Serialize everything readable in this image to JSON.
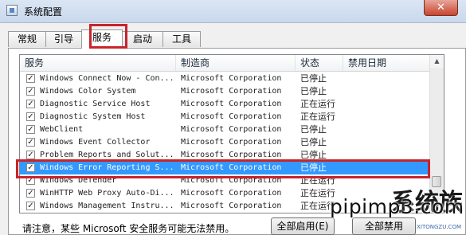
{
  "window": {
    "title": "系统配置",
    "close_glyph": "✕"
  },
  "tabs": [
    {
      "label": "常规"
    },
    {
      "label": "引导"
    },
    {
      "label": "服务",
      "active": true
    },
    {
      "label": "启动"
    },
    {
      "label": "工具"
    }
  ],
  "table": {
    "columns": [
      "服务",
      "制造商",
      "状态",
      "禁用日期"
    ],
    "rows": [
      {
        "name": "Windows Connect Now - Con...",
        "vendor": "Microsoft Corporation",
        "status": "已停止",
        "checked": true
      },
      {
        "name": "Windows Color System",
        "vendor": "Microsoft Corporation",
        "status": "已停止",
        "checked": true
      },
      {
        "name": "Diagnostic Service Host",
        "vendor": "Microsoft Corporation",
        "status": "正在运行",
        "checked": true
      },
      {
        "name": "Diagnostic System Host",
        "vendor": "Microsoft Corporation",
        "status": "正在运行",
        "checked": true
      },
      {
        "name": "WebClient",
        "vendor": "Microsoft Corporation",
        "status": "已停止",
        "checked": true
      },
      {
        "name": "Windows Event Collector",
        "vendor": "Microsoft Corporation",
        "status": "已停止",
        "checked": true
      },
      {
        "name": "Problem Reports and Solut...",
        "vendor": "Microsoft Corporation",
        "status": "已停止",
        "checked": true
      },
      {
        "name": "Windows Error Reporting S...",
        "vendor": "Microsoft Corporation",
        "status": "已停止",
        "checked": true,
        "selected": true
      },
      {
        "name": "Windows Defender",
        "vendor": "Microsoft Corporation",
        "status": "正在运行",
        "checked": true
      },
      {
        "name": "WinHTTP Web Proxy Auto-Di...",
        "vendor": "Microsoft Corporation",
        "status": "正在运行",
        "checked": true
      },
      {
        "name": "Windows Management Instru...",
        "vendor": "Microsoft Corporation",
        "status": "正在运行",
        "checked": true
      }
    ]
  },
  "footer": {
    "note": "请注意，某些 Microsoft 安全服务可能无法禁用。",
    "enable_all": "全部启用(E)",
    "disable_all": "全部禁用"
  },
  "watermark": {
    "text": "pipimp3.com",
    "brand": "系统族",
    "url": "XITONGZU.COM"
  },
  "colors": {
    "selection": "#3399ff",
    "highlight_box": "#c8242b"
  }
}
